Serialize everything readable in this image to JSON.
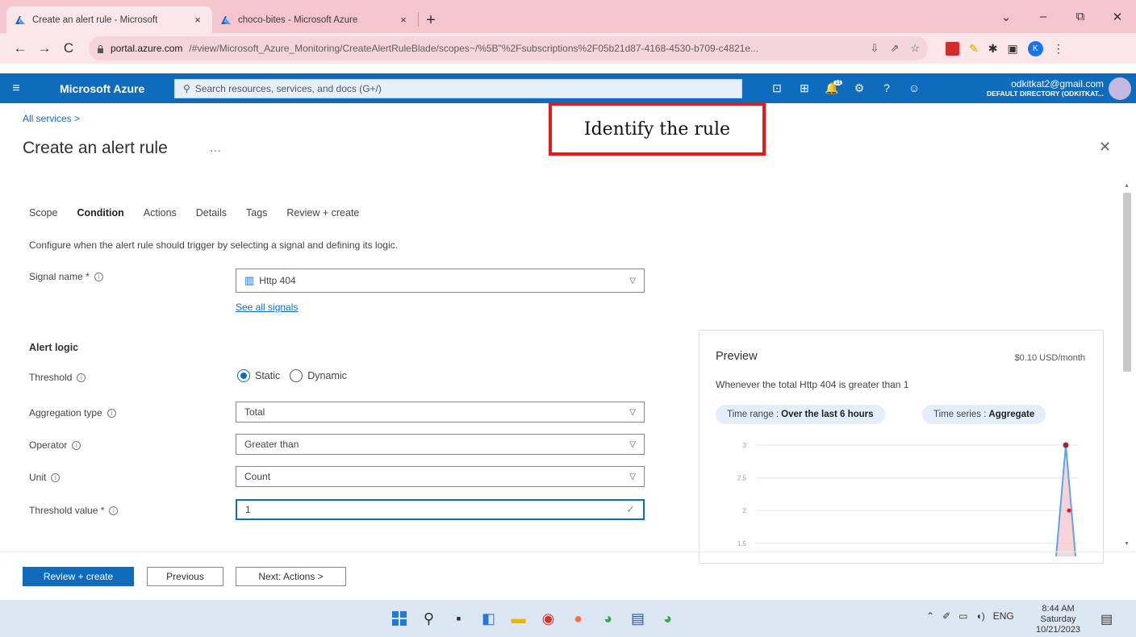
{
  "browser": {
    "tabs": [
      {
        "title": "Create an alert rule - Microsoft",
        "close": "×",
        "active": true
      },
      {
        "title": "choco-bites - Microsoft Azure",
        "close": "×",
        "active": false
      }
    ],
    "new_tab": "+",
    "window_controls": {
      "dropdown": "⌄",
      "minimize": "–",
      "restore": "⧉",
      "close": "✕"
    },
    "nav": {
      "back": "←",
      "forward": "→",
      "reload": "C"
    },
    "url_domain": "portal.azure.com",
    "url_rest": "/#view/Microsoft_Azure_Monitoring/CreateAlertRuleBlade/scopes~/%5B\"%2Fsubscriptions%2F05b21d87-4168-4530-b709-c4821e...",
    "profile_initial": "K"
  },
  "azure": {
    "menu_icon": "≡",
    "brand": "Microsoft Azure",
    "search_placeholder": "Search resources, services, and docs (G+/)",
    "notification_count": "11",
    "account_email": "odkitkat2@gmail.com",
    "account_directory": "DEFAULT DIRECTORY (ODKITKAT..."
  },
  "page": {
    "breadcrumb": "All services  >",
    "title": "Create an alert rule",
    "more": "···",
    "close": "✕",
    "annotation": "Identify the rule",
    "tabs": [
      "Scope",
      "Condition",
      "Actions",
      "Details",
      "Tags",
      "Review + create"
    ],
    "selected_tab": "Condition",
    "description": "Configure when the alert rule should trigger by selecting a signal and defining its logic."
  },
  "form": {
    "signal_label": "Signal name",
    "signal_value": "Http 404",
    "see_all_signals": "See all signals",
    "alert_logic": "Alert logic",
    "threshold_label": "Threshold",
    "threshold_options": [
      "Static",
      "Dynamic"
    ],
    "threshold_selected": "Static",
    "aggregation_label": "Aggregation type",
    "aggregation_value": "Total",
    "operator_label": "Operator",
    "operator_value": "Greater than",
    "unit_label": "Unit",
    "unit_value": "Count",
    "threshold_value_label": "Threshold value",
    "threshold_value": "1",
    "required_mark": "*"
  },
  "preview": {
    "title": "Preview",
    "price": "$0.10 USD/month",
    "description": "Whenever the total Http 404 is greater than 1",
    "time_range_label": "Time range :",
    "time_range_value": "Over the last 6 hours",
    "time_series_label": "Time series :",
    "time_series_value": "Aggregate"
  },
  "chart_data": {
    "type": "line",
    "title": "",
    "xlabel": "",
    "ylabel": "",
    "yticks": [
      "3",
      "2.5",
      "2",
      "1.5"
    ],
    "ylim": [
      1.3,
      3.0
    ],
    "threshold": 2,
    "series": [
      {
        "x": [
          0.93,
          0.96,
          0.99
        ],
        "values": [
          1.3,
          3.0,
          1.3
        ]
      }
    ],
    "colors": {
      "line": "#5aa6e8",
      "peak": "#8b2e3a",
      "threshold": "#e81123"
    }
  },
  "footer": {
    "review_create": "Review + create",
    "previous": "Previous",
    "next": "Next: Actions >"
  },
  "taskbar": {
    "tray_lang": "ENG",
    "time": "8:44 AM",
    "day": "Saturday",
    "date": "10/21/2023"
  },
  "colors": {
    "azure_blue": "#0f6cbd",
    "tab_strip": "#f5c6cf",
    "annotation_border": "#e41b1b"
  }
}
